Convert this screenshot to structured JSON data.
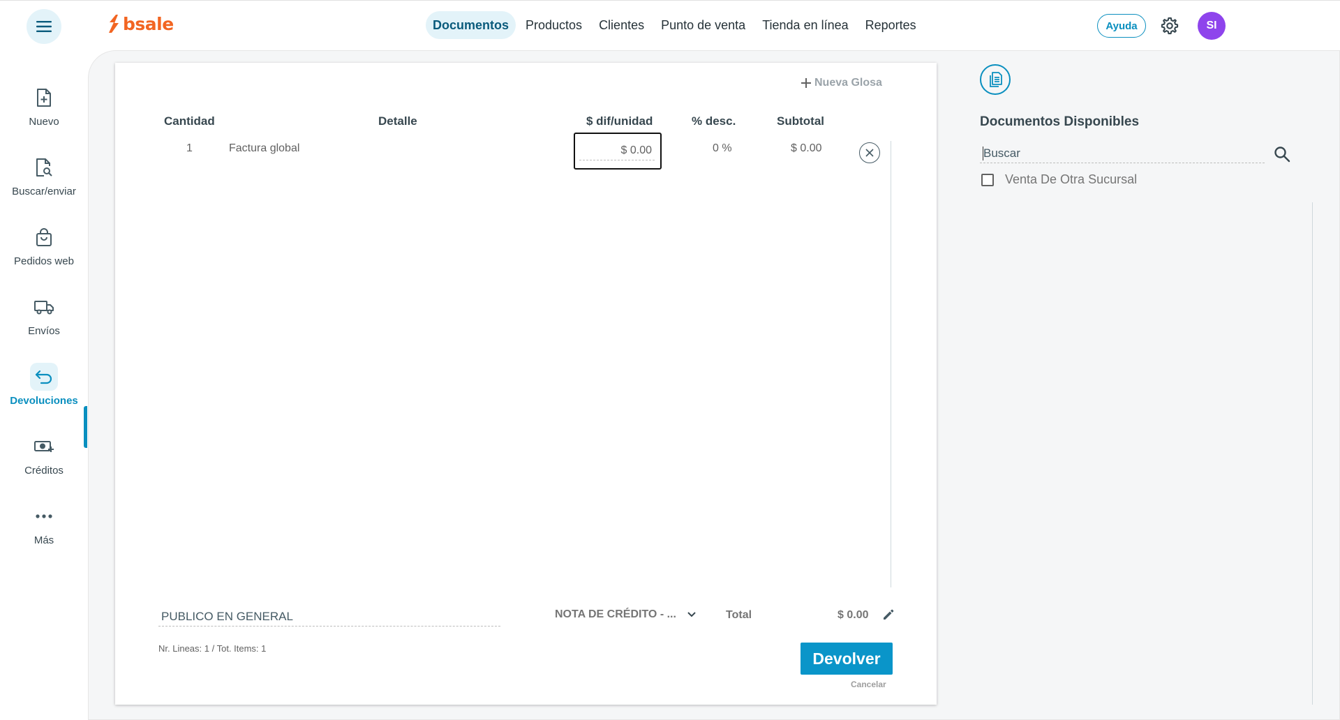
{
  "header": {
    "logo_text": "bsale",
    "nav": [
      {
        "label": "Documentos",
        "active": true
      },
      {
        "label": "Productos",
        "active": false
      },
      {
        "label": "Clientes",
        "active": false
      },
      {
        "label": "Punto de venta",
        "active": false
      },
      {
        "label": "Tienda en línea",
        "active": false
      },
      {
        "label": "Reportes",
        "active": false
      }
    ],
    "help_label": "Ayuda",
    "avatar_initials": "SI",
    "brand_color": "#f26522",
    "accent_color": "#0a8fbf",
    "avatar_color": "#8e44ec"
  },
  "sidebar": {
    "items": [
      {
        "label": "Nuevo",
        "icon": "file-plus-icon"
      },
      {
        "label": "Buscar/enviar",
        "icon": "file-search-icon"
      },
      {
        "label": "Pedidos web",
        "icon": "shopping-bag-icon"
      },
      {
        "label": "Envíos",
        "icon": "truck-icon"
      },
      {
        "label": "Devoluciones",
        "icon": "return-arrow-icon",
        "active": true
      },
      {
        "label": "Créditos",
        "icon": "cash-plus-icon"
      },
      {
        "label": "Más",
        "icon": "more-dots-icon"
      }
    ]
  },
  "document": {
    "new_glosa_label": "Nueva Glosa",
    "columns": {
      "quantity": "Cantidad",
      "detail": "Detalle",
      "unit_diff": "$ dif/unidad",
      "discount": "% desc.",
      "subtotal": "Subtotal"
    },
    "rows": [
      {
        "quantity": "1",
        "detail": "Factura global",
        "unit_diff": "$ 0.00",
        "discount": "0 %",
        "subtotal": "$ 0.00"
      }
    ],
    "client": "PUBLICO EN GENERAL",
    "doc_type": "NOTA DE CRÉDITO - ...",
    "total_label": "Total",
    "total_value": "$ 0.00",
    "summary": "Nr. Lineas: 1 / Tot. Items: 1",
    "return_button": "Devolver",
    "cancel_link": "Cancelar"
  },
  "panel": {
    "title": "Documentos Disponibles",
    "search_value": "Buscar",
    "checkbox_label": "Venta De Otra Sucursal",
    "checkbox_checked": false
  }
}
